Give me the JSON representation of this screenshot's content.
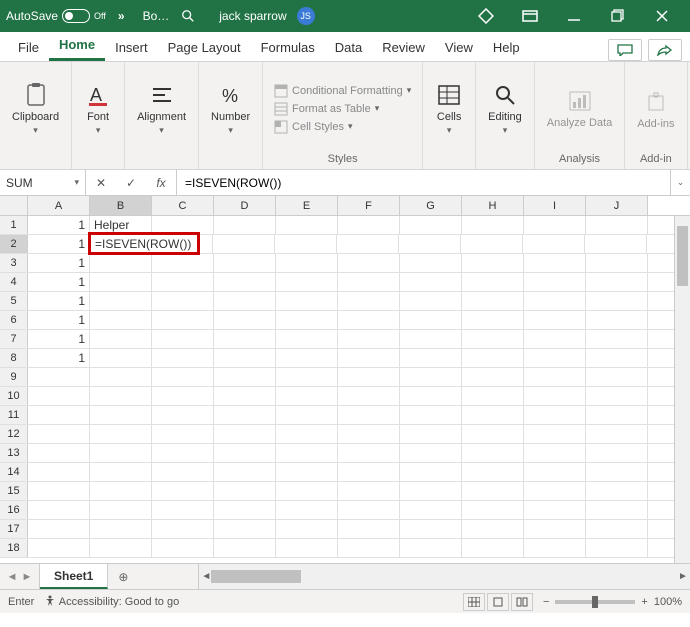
{
  "titlebar": {
    "autosave": "AutoSave",
    "autosave_state": "Off",
    "more": "»",
    "doc_name": "Bo…",
    "user": "jack sparrow",
    "avatar": "JS"
  },
  "tabs": {
    "file": "File",
    "home": "Home",
    "insert": "Insert",
    "page_layout": "Page Layout",
    "formulas": "Formulas",
    "data": "Data",
    "review": "Review",
    "view": "View",
    "help": "Help"
  },
  "ribbon": {
    "clipboard": "Clipboard",
    "font": "Font",
    "alignment": "Alignment",
    "number": "Number",
    "cond_fmt": "Conditional Formatting",
    "fmt_table": "Format as Table",
    "cell_styles": "Cell Styles",
    "styles": "Styles",
    "cells": "Cells",
    "editing": "Editing",
    "analyze": "Analyze Data",
    "analysis": "Analysis",
    "addins": "Add-ins",
    "addins_group": "Add-in"
  },
  "formula_bar": {
    "namebox": "SUM",
    "formula": "=ISEVEN(ROW())"
  },
  "grid": {
    "columns": [
      "A",
      "B",
      "C",
      "D",
      "E",
      "F",
      "G",
      "H",
      "I",
      "J"
    ],
    "row_headers": [
      1,
      2,
      3,
      4,
      5,
      6,
      7,
      8,
      9,
      10,
      11,
      12,
      13,
      14,
      15,
      16,
      17,
      18
    ],
    "active_col": "B",
    "active_row": 2,
    "cells": {
      "A1": "1",
      "B1": "Helper",
      "A2": "1",
      "B2": "=ISEVEN(ROW())",
      "A3": "1",
      "A4": "1",
      "A5": "1",
      "A6": "1",
      "A7": "1",
      "A8": "1"
    }
  },
  "sheets": {
    "active": "Sheet1"
  },
  "status": {
    "mode": "Enter",
    "accessibility": "Accessibility: Good to go",
    "zoom": "100%"
  }
}
